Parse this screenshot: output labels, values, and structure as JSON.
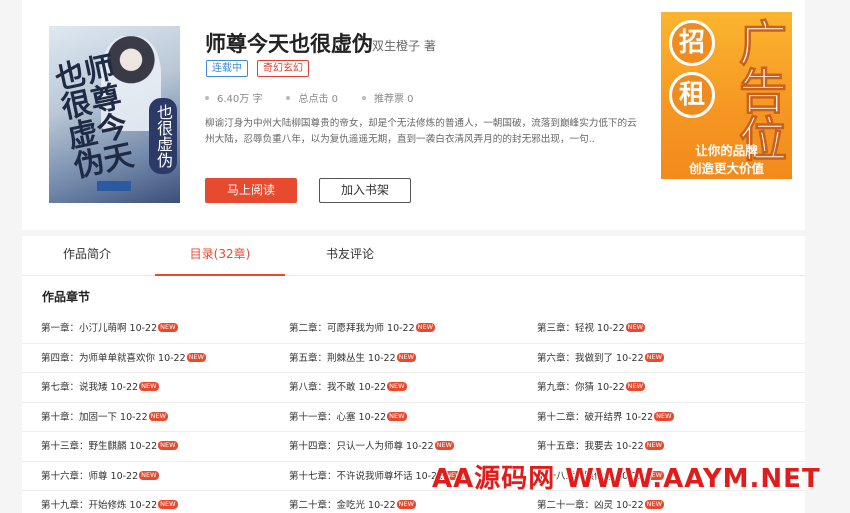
{
  "book": {
    "cover_title": "师尊今天也很虚伪",
    "cover_sub": "也很虚伪",
    "title": "师尊今天也很虚伪",
    "author": "双生橙子 著",
    "tags": [
      "连载中",
      "奇幻玄幻"
    ],
    "stats": [
      "6.40万 字",
      "总点击 0",
      "推荐票 0"
    ],
    "intro": "柳谕汀身为中州大陆柳国尊贵的帝女，却是个无法修炼的普通人，一朝国破，流落到巅峰实力低下的云州大陆，忍辱负重八年，以为复仇遥遥无期，直到一袭白衣清风弄月的的封无邪出现，一句..",
    "read_button": "马上阅读",
    "shelf_button": "加入书架"
  },
  "ad": {
    "char1": "招",
    "char2": "租",
    "big": "广告位",
    "slogan1": "让你的品牌",
    "slogan2": "创造更大价值"
  },
  "tabs": [
    "作品简介",
    "目录(32章)",
    "书友评论"
  ],
  "section_title": "作品章节",
  "new_badge": "NEW",
  "chapters": [
    [
      "第一章：小汀儿萌啊 10-22",
      "第二章：可愿拜我为师 10-22",
      "第三章：轻视 10-22"
    ],
    [
      "第四章：为师单单就喜欢你 10-22",
      "第五章：荆棘丛生 10-22",
      "第六章：我做到了 10-22"
    ],
    [
      "第七章：说我矮 10-22",
      "第八章：我不敢 10-22",
      "第九章：你猜 10-22"
    ],
    [
      "第十章：加固一下 10-22",
      "第十一章：心塞 10-22",
      "第十二章：破开结界 10-22"
    ],
    [
      "第十三章：野生麒麟 10-22",
      "第十四章：只认一人为师尊 10-22",
      "第十五章：我要去 10-22"
    ],
    [
      "第十六章：师尊 10-22",
      "第十七章：不许说我师尊坏话 10-22",
      "第十八章：跟你走 10-22"
    ],
    [
      "第十九章：开始修炼 10-22",
      "第二十章：金吃光 10-22",
      "第二十一章：凶灵 10-22"
    ]
  ],
  "watermark": "AA源码网 WWW.AAYM.NET"
}
